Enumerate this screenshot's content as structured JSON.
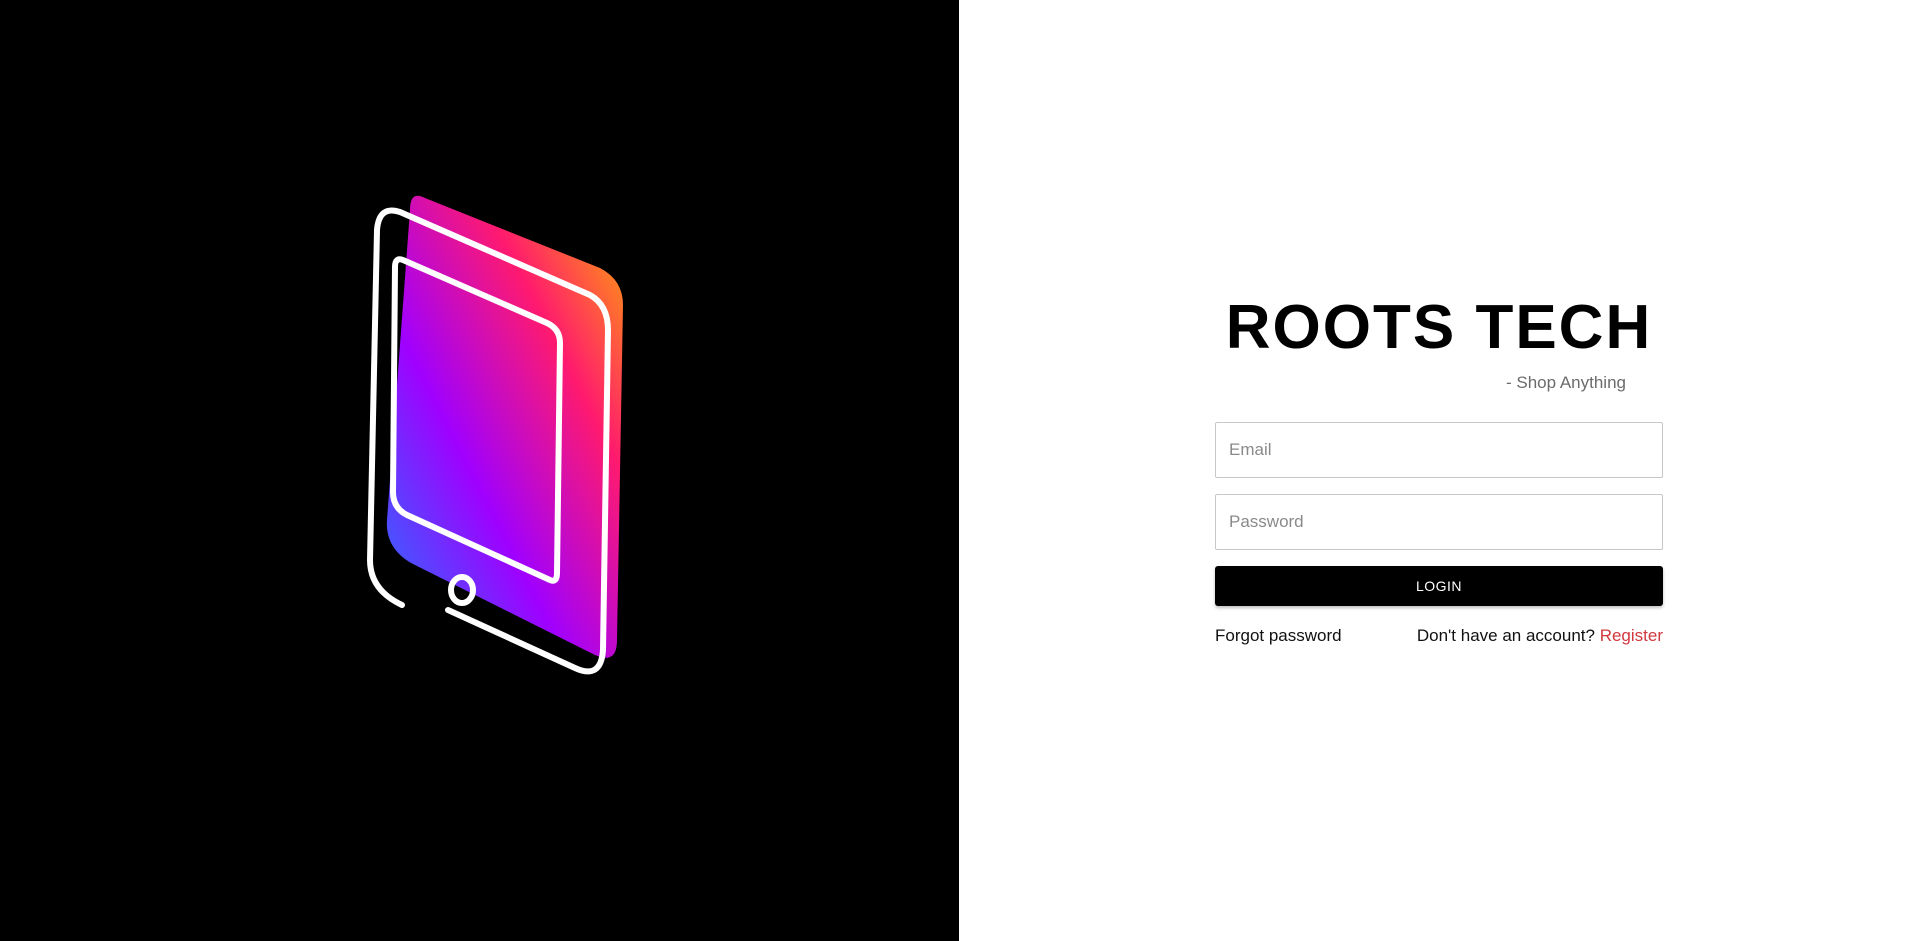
{
  "brand": {
    "title": "ROOTS TECH",
    "tagline": "- Shop Anything"
  },
  "illustration": {
    "icon": "tablet-icon",
    "gradient_colors": [
      "#ffb000",
      "#ff1a6e",
      "#a000ff",
      "#1e7bff"
    ],
    "outline_color": "#ffffff",
    "background_color": "#000000"
  },
  "login_form": {
    "email_placeholder": "Email",
    "email_value": "",
    "password_placeholder": "Password",
    "password_value": "",
    "login_label": "LOGIN",
    "forgot_password_label": "Forgot password",
    "no_account_text": "Don't have an account?",
    "register_label": "Register"
  },
  "colors": {
    "accent_register": "#d0383e",
    "button_bg": "#000000",
    "button_text": "#ffffff"
  }
}
